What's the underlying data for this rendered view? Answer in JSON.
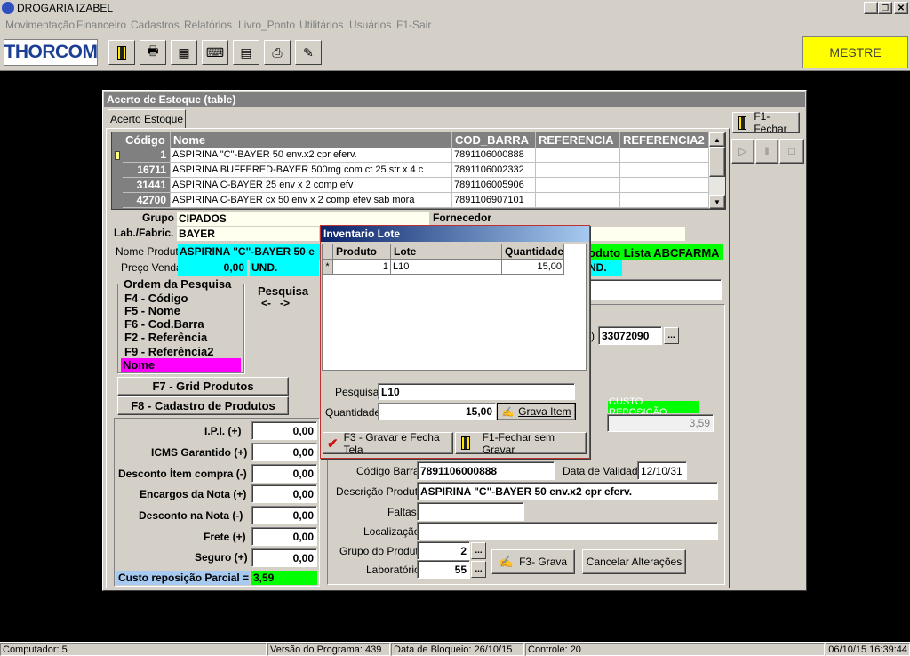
{
  "app": {
    "title": "DROGARIA IZABEL",
    "logo": "THORCOM",
    "mode": "MESTRE"
  },
  "menu": [
    "Movimentação",
    "Financeiro",
    "Cadastros",
    "Relatórios",
    "Livro_Ponto",
    "Utilitários",
    "Usuários",
    "F1-Sair"
  ],
  "form": {
    "title": "Acerto de Estoque  (table)",
    "tab": "Acerto Estoque",
    "close_button": "F1-Fechar",
    "grid": {
      "headers": [
        "Código",
        "Nome",
        "COD_BARRA",
        "REFERENCIA",
        "REFERENCIA2"
      ],
      "rows": [
        {
          "codigo": "1",
          "nome": "ASPIRINA \"C\"-BAYER  50 env.x2 cpr eferv.",
          "barra": "7891106000888"
        },
        {
          "codigo": "16711",
          "nome": "ASPIRINA BUFFERED-BAYER  500mg com ct 25 str x 4 c",
          "barra": "7891106002332"
        },
        {
          "codigo": "31441",
          "nome": "ASPIRINA C-BAYER  25 env x 2 comp efv",
          "barra": "7891106005906"
        },
        {
          "codigo": "42700",
          "nome": "ASPIRINA C-BAYER  cx 50 env x 2 comp efev sab mora",
          "barra": "7891106907101"
        }
      ]
    },
    "grupo_label": "Grupo",
    "grupo_value": "CIPADOS",
    "fornecedor_label": "Fornecedor",
    "lab_label": "Lab./Fabric.",
    "lab_value": "BAYER",
    "nome_produto_label": "Nome Produto",
    "nome_produto_value": "ASPIRINA \"C\"-BAYER  50 e",
    "lista_label": "oduto Lista ABCFARMA",
    "preco_label": "Preço Venda",
    "preco_value": "0,00",
    "und": "UND.",
    "und2": "ND.",
    "ordem": {
      "title": "Ordem da Pesquisa",
      "items": [
        "F4 - Código",
        "F5 - Nome",
        "F6 - Cod.Barra",
        "F2 - Referência",
        "F9 - Referência2"
      ],
      "selected": "Nome"
    },
    "pesquisa_label": "Pesquisa",
    "arrows": "<-   ->",
    "ncm_paren": ")",
    "ncm_value": "33072090",
    "grid_button": "F7 - Grid Produtos",
    "cadastro_button": "F8 - Cadastro de Produtos",
    "custos": [
      {
        "label": "I.P.I. (+)",
        "value": "0,00"
      },
      {
        "label": "ICMS Garantido (+)",
        "value": "0,00"
      },
      {
        "label": "Desconto Ítem compra (-)",
        "value": "0,00"
      },
      {
        "label": "Encargos da Nota (+)",
        "value": "0,00"
      },
      {
        "label": "Desconto na Nota (-)",
        "value": "0,00"
      },
      {
        "label": "Frete (+)",
        "value": "0,00"
      },
      {
        "label": "Seguro (+)",
        "value": "0,00"
      }
    ],
    "custo_parcial_label": "Custo reposição Parcial =",
    "custo_parcial_value": "3,59",
    "custo_reposicao_label": "CUSTO REPOSIÇÃO",
    "custo_reposicao_value": "3,59",
    "codigo_barras_label": "Código Barras",
    "codigo_barras_value": "7891106000888",
    "validade_label": "Data de Validade",
    "validade_value": "12/10/31",
    "descricao_label": "Descrição Produto",
    "descricao_value": "ASPIRINA \"C\"-BAYER  50 env.x2 cpr eferv.",
    "faltas_label": "Faltas",
    "localizacao_label": "Localização",
    "grupo_produto_label": "Grupo do Produto",
    "grupo_produto_value": "2",
    "laboratorio_label": "Laboratório",
    "laboratorio_value": "55",
    "grava_button": "F3- Grava",
    "cancelar_button": "Cancelar Alterações"
  },
  "dialog": {
    "title": "Inventario Lote",
    "headers": [
      "Produto",
      "Lote",
      "Quantidade"
    ],
    "row": {
      "marker": "*",
      "produto": "1",
      "lote": "L10",
      "quantidade": "15,00"
    },
    "pesquisa_label": "Pesquisa:",
    "pesquisa_value": "L10",
    "quantidade_label": "Quantidade:",
    "quantidade_value": "15,00",
    "grava_item_button": "Grava Item",
    "gravar_fecha_button": "F3 - Gravar e Fecha Tela",
    "fechar_sem_gravar_button": "F1-Fechar sem Gravar"
  },
  "status": {
    "computador": "Computador: 5",
    "versao": "Versão do Programa: 439",
    "bloqueio": "Data de Bloqueio: 26/10/15",
    "controle": "Controle: 20",
    "datetime": "06/10/15 16:39:44"
  },
  "colors": {
    "titlebar": "#0a246a",
    "yellow": "#ffff00",
    "cyan": "#00ffff",
    "green": "#00ff00",
    "magenta": "#ff00ff",
    "lightblue": "#a6caf0"
  }
}
